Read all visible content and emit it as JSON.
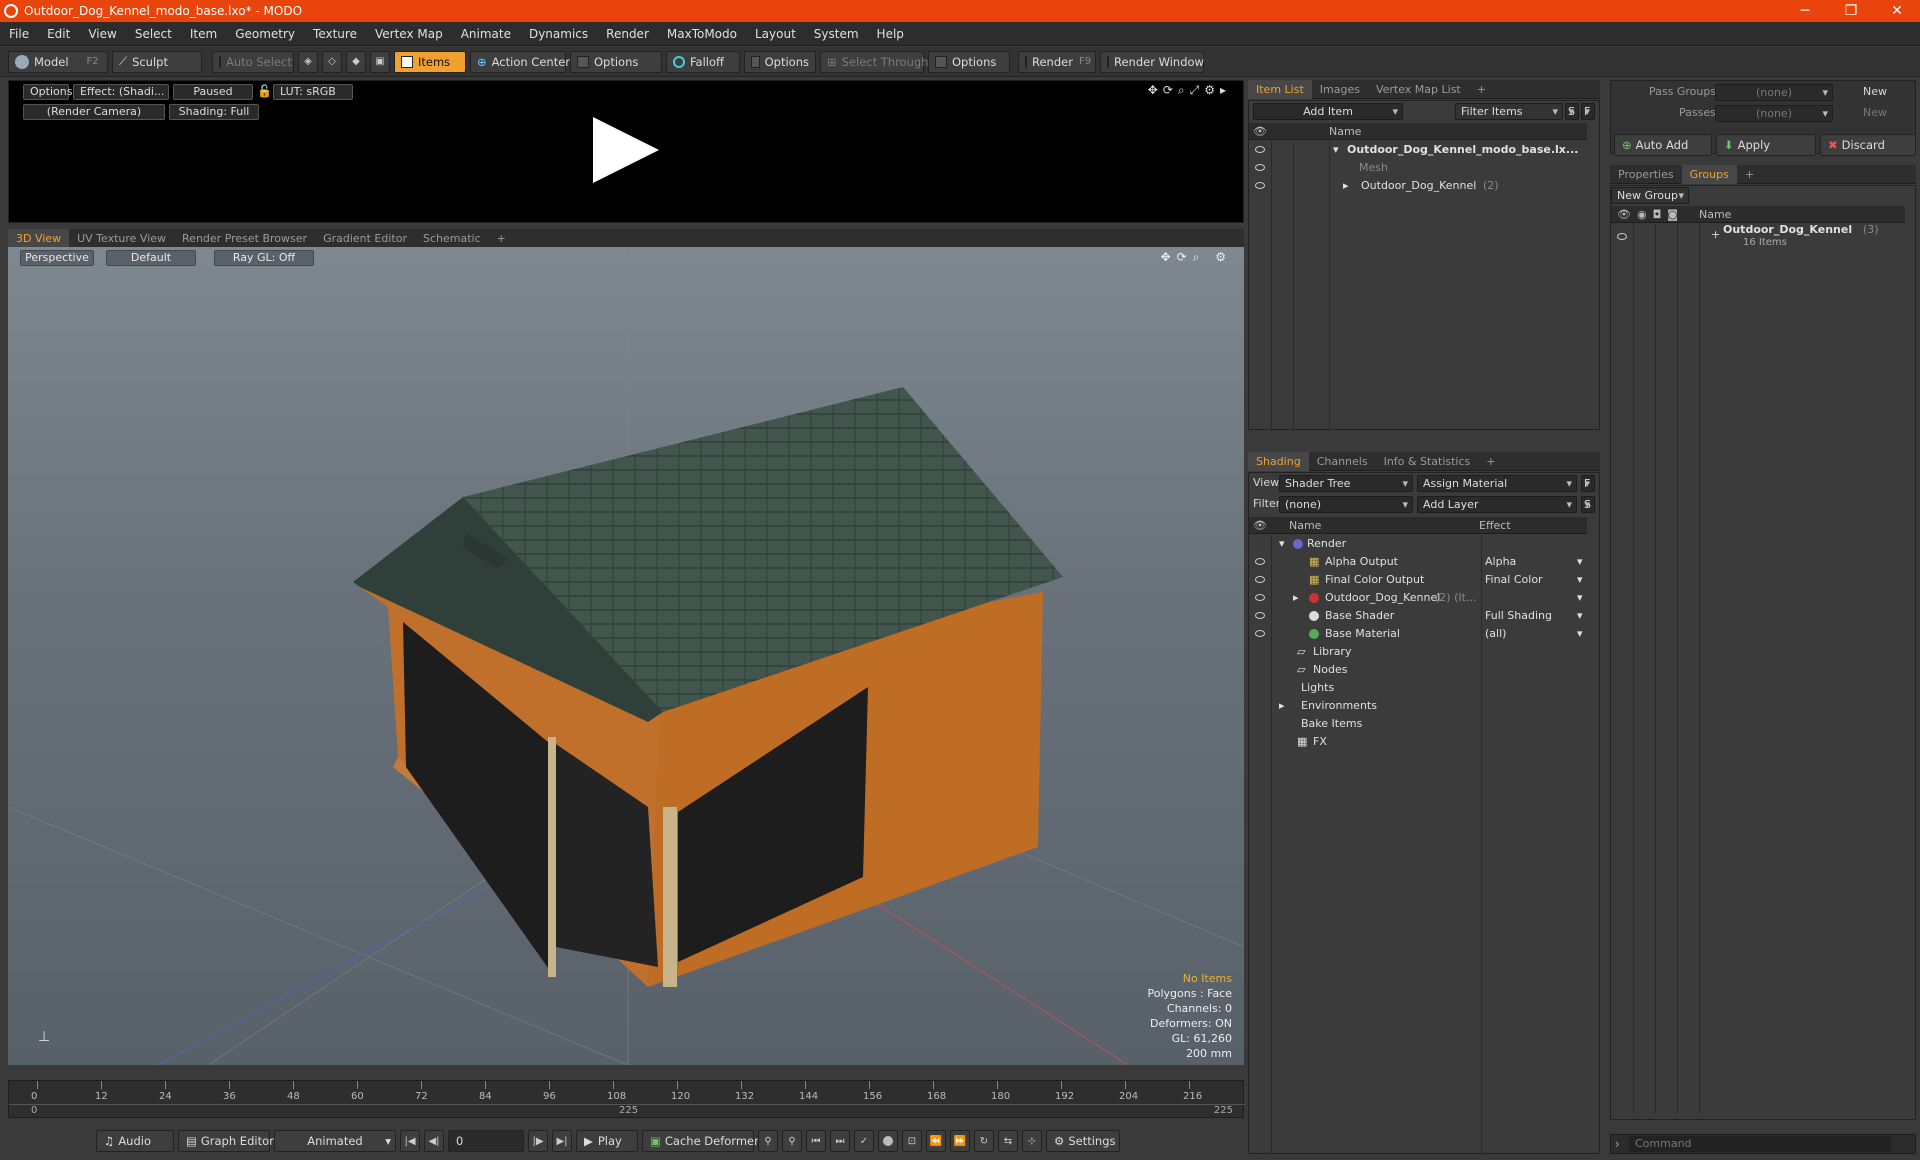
{
  "window": {
    "title": "Outdoor_Dog_Kennel_modo_base.lxo* - MODO",
    "controls": [
      "─",
      "❐",
      "✕"
    ]
  },
  "menu": [
    "File",
    "Edit",
    "View",
    "Select",
    "Item",
    "Geometry",
    "Texture",
    "Vertex Map",
    "Animate",
    "Dynamics",
    "Render",
    "MaxToModo",
    "Layout",
    "System",
    "Help"
  ],
  "toolbar": {
    "model": "Model",
    "model_key": "F2",
    "sculpt": "Sculpt",
    "auto_select": "Auto Select",
    "items": "Items",
    "action_center": "Action Center",
    "options1": "Options",
    "falloff": "Falloff",
    "options2": "Options",
    "select_through": "Select Through",
    "options3": "Options",
    "render": "Render",
    "render_key": "F9",
    "render_window": "Render Window"
  },
  "preview": {
    "options": "Options",
    "effect": "Effect: (Shadi...",
    "paused": "Paused",
    "lut": "LUT: sRGB",
    "camera": "(Render Camera)",
    "shading": "Shading: Full"
  },
  "viewport_tabs": [
    "3D View",
    "UV Texture View",
    "Render Preset Browser",
    "Gradient Editor",
    "Schematic",
    "+"
  ],
  "viewport": {
    "projection": "Perspective",
    "style": "Default",
    "raygl": "Ray GL: Off",
    "info": {
      "items": "No Items",
      "polygons": "Polygons : Face",
      "channels": "Channels: 0",
      "deformers": "Deformers: ON",
      "gl": "GL: 61,260",
      "scale": "200 mm"
    }
  },
  "timeline": {
    "ticks": [
      "0",
      "12",
      "24",
      "36",
      "48",
      "60",
      "72",
      "84",
      "96",
      "108",
      "120",
      "132",
      "144",
      "156",
      "168",
      "180",
      "192",
      "204",
      "216"
    ],
    "start": "0",
    "mid": "225",
    "end": "225"
  },
  "bottombar": {
    "audio": "Audio",
    "graph_editor": "Graph Editor",
    "animated": "Animated",
    "frame": "0",
    "play": "Play",
    "cache": "Cache Deformers",
    "settings": "Settings"
  },
  "item_list": {
    "tabs": [
      "Item List",
      "Images",
      "Vertex Map List",
      "+"
    ],
    "add_item": "Add Item",
    "filter_items": "Filter Items",
    "s": "S",
    "f": "F",
    "col_name": "Name",
    "rows": [
      {
        "label": "Outdoor_Dog_Kennel_modo_base.lx...",
        "count": ""
      },
      {
        "label": "Mesh",
        "count": ""
      },
      {
        "label": "Outdoor_Dog_Kennel",
        "count": "(2)"
      }
    ]
  },
  "shading": {
    "tabs": [
      "Shading",
      "Channels",
      "Info & Statistics",
      "+"
    ],
    "view_label": "View",
    "view_value": "Shader Tree",
    "assign_material": "Assign Material",
    "f": "F",
    "filter_label": "Filter",
    "filter_value": "(none)",
    "add_layer": "Add Layer",
    "s": "S",
    "col_name": "Name",
    "col_effect": "Effect",
    "rows": [
      {
        "name": "Render",
        "effect": ""
      },
      {
        "name": "Alpha Output",
        "effect": "Alpha"
      },
      {
        "name": "Final Color Output",
        "effect": "Final Color"
      },
      {
        "name": "Outdoor_Dog_Kennel",
        "extra": "(2) (It...",
        "effect": ""
      },
      {
        "name": "Base Shader",
        "effect": "Full Shading"
      },
      {
        "name": "Base Material",
        "effect": "(all)"
      },
      {
        "name": "Library",
        "effect": ""
      },
      {
        "name": "Nodes",
        "effect": ""
      },
      {
        "name": "Lights",
        "effect": ""
      },
      {
        "name": "Environments",
        "effect": ""
      },
      {
        "name": "Bake Items",
        "effect": ""
      },
      {
        "name": "FX",
        "effect": ""
      }
    ]
  },
  "right": {
    "pass_groups": "Pass Groups",
    "passes": "Passes",
    "none1": "(none)",
    "none2": "(none)",
    "new1": "New",
    "new2": "New",
    "auto_add": "Auto Add",
    "apply": "Apply",
    "discard": "Discard",
    "tabs": [
      "Properties",
      "Groups",
      "+"
    ],
    "new_group": "New Group",
    "col_name": "Name",
    "group_name": "Outdoor_Dog_Kennel",
    "group_count": "(3)",
    "group_items": "16 Items",
    "command": "Command"
  }
}
